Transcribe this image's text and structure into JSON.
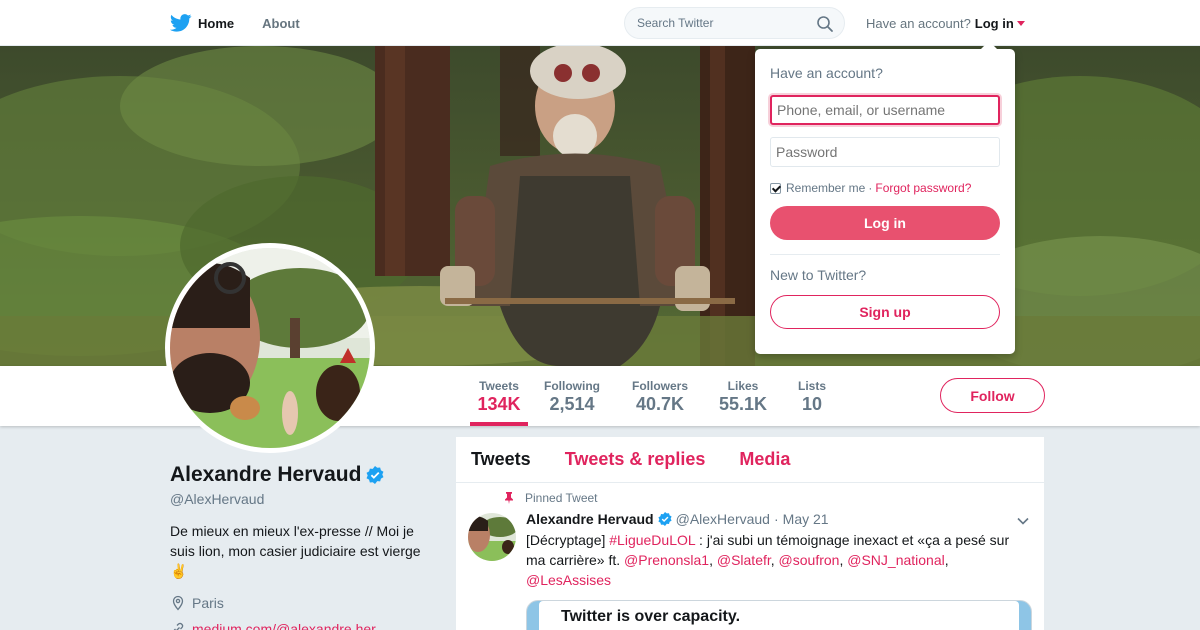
{
  "nav": {
    "home_label": "Home",
    "about_label": "About",
    "search_placeholder": "Search Twitter",
    "have_account": "Have an account?",
    "login_label": "Log in"
  },
  "profile": {
    "name": "Alexandre Hervaud",
    "handle": "@AlexHervaud",
    "bio": "De mieux en mieux l'ex-presse // Moi je suis lion, mon casier judiciaire est vierge ✌️",
    "location": "Paris",
    "link": "medium.com/@alexandre.her..."
  },
  "stats": [
    {
      "label": "Tweets",
      "value": "134K"
    },
    {
      "label": "Following",
      "value": "2,514"
    },
    {
      "label": "Followers",
      "value": "40.7K"
    },
    {
      "label": "Likes",
      "value": "55.1K"
    },
    {
      "label": "Lists",
      "value": "10"
    }
  ],
  "follow_label": "Follow",
  "timeline": {
    "tabs": [
      "Tweets",
      "Tweets & replies",
      "Media"
    ],
    "tweet": {
      "pinned_label": "Pinned Tweet",
      "author": "Alexandre Hervaud",
      "handle": "@AlexHervaud",
      "separator": "·",
      "date": "May 21",
      "text_1": "[Décryptage] ",
      "hashtag": "#LigueDuLOL",
      "text_2": " : j'ai subi un témoignage inexact et «ça a pesé sur ma carrière» ft. ",
      "mentions": [
        "@Prenonsla1",
        "@Slatefr",
        "@soufron",
        "@SNJ_national",
        "@LesAssises"
      ],
      "card_title": "Twitter is over capacity."
    }
  },
  "login_dropdown": {
    "title": "Have an account?",
    "username_placeholder": "Phone, email, or username",
    "password_placeholder": "Password",
    "remember_label": "Remember me",
    "separator": "·",
    "forgot_label": "Forgot password?",
    "login_button": "Log in",
    "new_label": "New to Twitter?",
    "signup_button": "Sign up"
  },
  "colors": {
    "accent": "#e0245e",
    "login_button_bg": "#e8516f",
    "verified": "#1da1f2",
    "bird": "#1da1f2",
    "page_bg": "#e6ecf0"
  }
}
